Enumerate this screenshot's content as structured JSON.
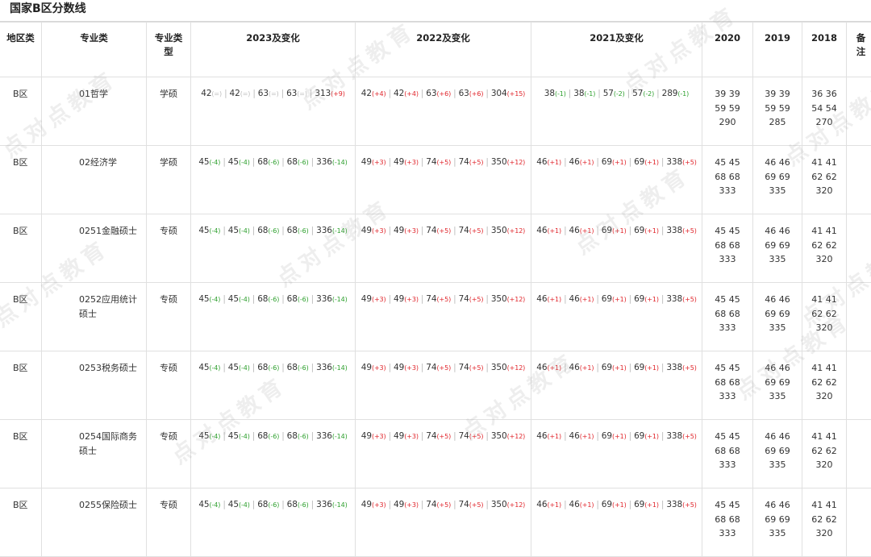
{
  "title": "国家B区分数线",
  "headers": {
    "region": "地区类",
    "major": "专业类",
    "type": "专业类型",
    "y2023": "2023及变化",
    "y2022": "2022及变化",
    "y2021": "2021及变化",
    "y2020": "2020",
    "y2019": "2019",
    "y2018": "2018",
    "note": "备注"
  },
  "watermark": "点对点教育",
  "rows": [
    {
      "region": "B区",
      "major": "01哲学",
      "type": "学硕",
      "y2023": [
        [
          "42",
          "(=)",
          "zero"
        ],
        [
          "42",
          "(=)",
          "zero"
        ],
        [
          "63",
          "(=)",
          "zero"
        ],
        [
          "63",
          "(=)",
          "zero"
        ],
        [
          "313",
          "(+9)",
          "up"
        ]
      ],
      "y2022": [
        [
          "42",
          "(+4)",
          "up"
        ],
        [
          "42",
          "(+4)",
          "up"
        ],
        [
          "63",
          "(+6)",
          "up"
        ],
        [
          "63",
          "(+6)",
          "up"
        ],
        [
          "304",
          "(+15)",
          "up"
        ]
      ],
      "y2021": [
        [
          "38",
          "(-1)",
          "down"
        ],
        [
          "38",
          "(-1)",
          "down"
        ],
        [
          "57",
          "(-2)",
          "down"
        ],
        [
          "57",
          "(-2)",
          "down"
        ],
        [
          "289",
          "(-1)",
          "down"
        ]
      ],
      "y2020": [
        "39 39",
        "59 59",
        "290"
      ],
      "y2019": [
        "39 39",
        "59 59",
        "285"
      ],
      "y2018": [
        "36 36",
        "54 54",
        "270"
      ]
    },
    {
      "region": "B区",
      "major": "02经济学",
      "type": "学硕",
      "y2023": [
        [
          "45",
          "(-4)",
          "down"
        ],
        [
          "45",
          "(-4)",
          "down"
        ],
        [
          "68",
          "(-6)",
          "down"
        ],
        [
          "68",
          "(-6)",
          "down"
        ],
        [
          "336",
          "(-14)",
          "down"
        ]
      ],
      "y2022": [
        [
          "49",
          "(+3)",
          "up"
        ],
        [
          "49",
          "(+3)",
          "up"
        ],
        [
          "74",
          "(+5)",
          "up"
        ],
        [
          "74",
          "(+5)",
          "up"
        ],
        [
          "350",
          "(+12)",
          "up"
        ]
      ],
      "y2021": [
        [
          "46",
          "(+1)",
          "up"
        ],
        [
          "46",
          "(+1)",
          "up"
        ],
        [
          "69",
          "(+1)",
          "up"
        ],
        [
          "69",
          "(+1)",
          "up"
        ],
        [
          "338",
          "(+5)",
          "up"
        ]
      ],
      "y2020": [
        "45 45",
        "68 68",
        "333"
      ],
      "y2019": [
        "46 46",
        "69 69",
        "335"
      ],
      "y2018": [
        "41 41",
        "62 62",
        "320"
      ]
    },
    {
      "region": "B区",
      "major": "0251金融硕士",
      "type": "专硕",
      "y2023": [
        [
          "45",
          "(-4)",
          "down"
        ],
        [
          "45",
          "(-4)",
          "down"
        ],
        [
          "68",
          "(-6)",
          "down"
        ],
        [
          "68",
          "(-6)",
          "down"
        ],
        [
          "336",
          "(-14)",
          "down"
        ]
      ],
      "y2022": [
        [
          "49",
          "(+3)",
          "up"
        ],
        [
          "49",
          "(+3)",
          "up"
        ],
        [
          "74",
          "(+5)",
          "up"
        ],
        [
          "74",
          "(+5)",
          "up"
        ],
        [
          "350",
          "(+12)",
          "up"
        ]
      ],
      "y2021": [
        [
          "46",
          "(+1)",
          "up"
        ],
        [
          "46",
          "(+1)",
          "up"
        ],
        [
          "69",
          "(+1)",
          "up"
        ],
        [
          "69",
          "(+1)",
          "up"
        ],
        [
          "338",
          "(+5)",
          "up"
        ]
      ],
      "y2020": [
        "45 45",
        "68 68",
        "333"
      ],
      "y2019": [
        "46 46",
        "69 69",
        "335"
      ],
      "y2018": [
        "41 41",
        "62 62",
        "320"
      ]
    },
    {
      "region": "B区",
      "major": "0252应用统计硕士",
      "type": "专硕",
      "y2023": [
        [
          "45",
          "(-4)",
          "down"
        ],
        [
          "45",
          "(-4)",
          "down"
        ],
        [
          "68",
          "(-6)",
          "down"
        ],
        [
          "68",
          "(-6)",
          "down"
        ],
        [
          "336",
          "(-14)",
          "down"
        ]
      ],
      "y2022": [
        [
          "49",
          "(+3)",
          "up"
        ],
        [
          "49",
          "(+3)",
          "up"
        ],
        [
          "74",
          "(+5)",
          "up"
        ],
        [
          "74",
          "(+5)",
          "up"
        ],
        [
          "350",
          "(+12)",
          "up"
        ]
      ],
      "y2021": [
        [
          "46",
          "(+1)",
          "up"
        ],
        [
          "46",
          "(+1)",
          "up"
        ],
        [
          "69",
          "(+1)",
          "up"
        ],
        [
          "69",
          "(+1)",
          "up"
        ],
        [
          "338",
          "(+5)",
          "up"
        ]
      ],
      "y2020": [
        "45 45",
        "68 68",
        "333"
      ],
      "y2019": [
        "46 46",
        "69 69",
        "335"
      ],
      "y2018": [
        "41 41",
        "62 62",
        "320"
      ]
    },
    {
      "region": "B区",
      "major": "0253税务硕士",
      "type": "专硕",
      "y2023": [
        [
          "45",
          "(-4)",
          "down"
        ],
        [
          "45",
          "(-4)",
          "down"
        ],
        [
          "68",
          "(-6)",
          "down"
        ],
        [
          "68",
          "(-6)",
          "down"
        ],
        [
          "336",
          "(-14)",
          "down"
        ]
      ],
      "y2022": [
        [
          "49",
          "(+3)",
          "up"
        ],
        [
          "49",
          "(+3)",
          "up"
        ],
        [
          "74",
          "(+5)",
          "up"
        ],
        [
          "74",
          "(+5)",
          "up"
        ],
        [
          "350",
          "(+12)",
          "up"
        ]
      ],
      "y2021": [
        [
          "46",
          "(+1)",
          "up"
        ],
        [
          "46",
          "(+1)",
          "up"
        ],
        [
          "69",
          "(+1)",
          "up"
        ],
        [
          "69",
          "(+1)",
          "up"
        ],
        [
          "338",
          "(+5)",
          "up"
        ]
      ],
      "y2020": [
        "45 45",
        "68 68",
        "333"
      ],
      "y2019": [
        "46 46",
        "69 69",
        "335"
      ],
      "y2018": [
        "41 41",
        "62 62",
        "320"
      ]
    },
    {
      "region": "B区",
      "major": "0254国际商务硕士",
      "type": "专硕",
      "y2023": [
        [
          "45",
          "(-4)",
          "down"
        ],
        [
          "45",
          "(-4)",
          "down"
        ],
        [
          "68",
          "(-6)",
          "down"
        ],
        [
          "68",
          "(-6)",
          "down"
        ],
        [
          "336",
          "(-14)",
          "down"
        ]
      ],
      "y2022": [
        [
          "49",
          "(+3)",
          "up"
        ],
        [
          "49",
          "(+3)",
          "up"
        ],
        [
          "74",
          "(+5)",
          "up"
        ],
        [
          "74",
          "(+5)",
          "up"
        ],
        [
          "350",
          "(+12)",
          "up"
        ]
      ],
      "y2021": [
        [
          "46",
          "(+1)",
          "up"
        ],
        [
          "46",
          "(+1)",
          "up"
        ],
        [
          "69",
          "(+1)",
          "up"
        ],
        [
          "69",
          "(+1)",
          "up"
        ],
        [
          "338",
          "(+5)",
          "up"
        ]
      ],
      "y2020": [
        "45 45",
        "68 68",
        "333"
      ],
      "y2019": [
        "46 46",
        "69 69",
        "335"
      ],
      "y2018": [
        "41 41",
        "62 62",
        "320"
      ]
    },
    {
      "region": "B区",
      "major": "0255保险硕士",
      "type": "专硕",
      "y2023": [
        [
          "45",
          "(-4)",
          "down"
        ],
        [
          "45",
          "(-4)",
          "down"
        ],
        [
          "68",
          "(-6)",
          "down"
        ],
        [
          "68",
          "(-6)",
          "down"
        ],
        [
          "336",
          "(-14)",
          "down"
        ]
      ],
      "y2022": [
        [
          "49",
          "(+3)",
          "up"
        ],
        [
          "49",
          "(+3)",
          "up"
        ],
        [
          "74",
          "(+5)",
          "up"
        ],
        [
          "74",
          "(+5)",
          "up"
        ],
        [
          "350",
          "(+12)",
          "up"
        ]
      ],
      "y2021": [
        [
          "46",
          "(+1)",
          "up"
        ],
        [
          "46",
          "(+1)",
          "up"
        ],
        [
          "69",
          "(+1)",
          "up"
        ],
        [
          "69",
          "(+1)",
          "up"
        ],
        [
          "338",
          "(+5)",
          "up"
        ]
      ],
      "y2020": [
        "45 45",
        "68 68",
        "333"
      ],
      "y2019": [
        "46 46",
        "69 69",
        "335"
      ],
      "y2018": [
        "41 41",
        "62 62",
        "320"
      ]
    }
  ]
}
